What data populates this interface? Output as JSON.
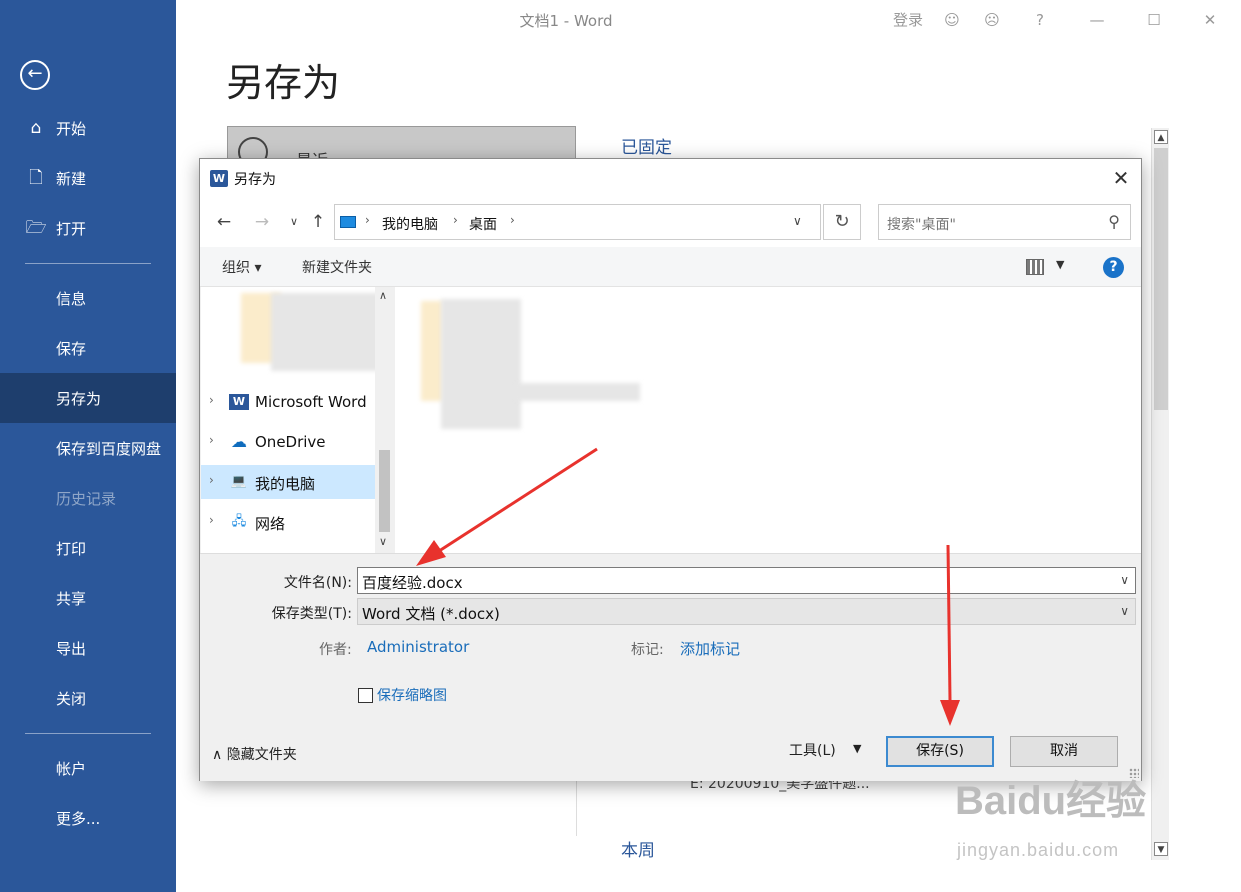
{
  "window": {
    "title": "文档1  -  Word",
    "signin": "登录",
    "help": "?"
  },
  "sidebar": {
    "items": [
      {
        "label": "开始"
      },
      {
        "label": "新建"
      },
      {
        "label": "打开"
      },
      {
        "label": "信息"
      },
      {
        "label": "保存"
      },
      {
        "label": "另存为",
        "active": true
      },
      {
        "label": "保存到百度网盘"
      },
      {
        "label": "历史记录",
        "disabled": true
      },
      {
        "label": "打印"
      },
      {
        "label": "共享"
      },
      {
        "label": "导出"
      },
      {
        "label": "关闭"
      },
      {
        "label": "帐户"
      },
      {
        "label": "更多..."
      }
    ]
  },
  "backstage": {
    "title": "另存为",
    "recent_label": "最近",
    "pinned": "已固定",
    "this_week": "本周",
    "recent_file": "E:  20200910_美学盛件题..."
  },
  "dialog": {
    "title": "另存为",
    "breadcrumb": [
      "我的电脑",
      "桌面"
    ],
    "search_placeholder": "搜索\"桌面\"",
    "toolbar": {
      "organize": "组织 ▾",
      "new_folder": "新建文件夹"
    },
    "tree": [
      "Microsoft Word",
      "OneDrive",
      "我的电脑",
      "网络"
    ],
    "filename_label": "文件名(N):",
    "filename": "百度经验.docx",
    "filetype_label": "保存类型(T):",
    "filetype": "Word 文档 (*.docx)",
    "author_label": "作者:",
    "author": "Administrator",
    "tags_label": "标记:",
    "tags": "添加标记",
    "thumbnail": "保存缩略图",
    "hide_folders": "隐藏文件夹",
    "tools": "工具(L)",
    "save": "保存(S)",
    "cancel": "取消"
  },
  "watermark": {
    "brand": "Baidu经验",
    "url": "jingyan.baidu.com"
  },
  "colors": {
    "accent": "#2b579a",
    "annotation_arrow": "#e8322d"
  }
}
